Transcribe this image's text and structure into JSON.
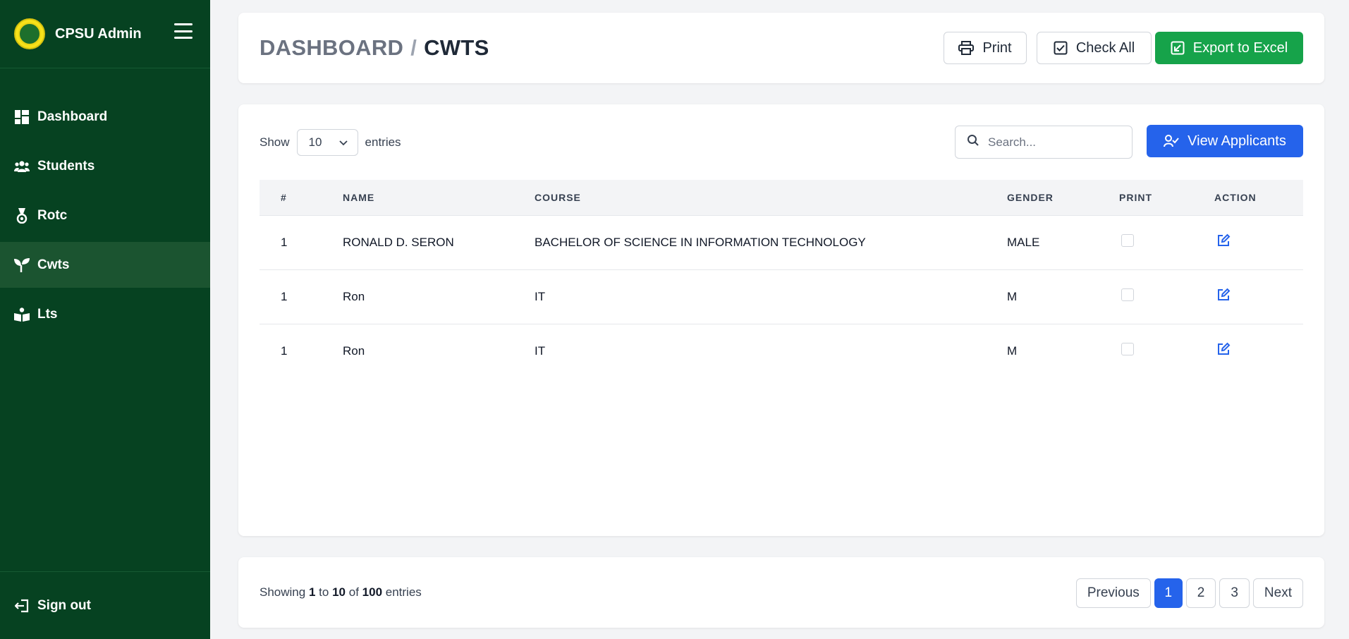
{
  "sidebar": {
    "brand_title": "CPSU Admin",
    "items": [
      {
        "label": "Dashboard",
        "icon": "dashboard-icon",
        "active": false
      },
      {
        "label": "Students",
        "icon": "users-icon",
        "active": false
      },
      {
        "label": "Rotc",
        "icon": "medal-icon",
        "active": false
      },
      {
        "label": "Cwts",
        "icon": "seedling-icon",
        "active": true
      },
      {
        "label": "Lts",
        "icon": "reader-icon",
        "active": false
      }
    ],
    "signout_label": "Sign out"
  },
  "header": {
    "crumb_root": "DASHBOARD",
    "crumb_sep": "/",
    "crumb_current": "CWTS",
    "print_label": "Print",
    "check_all_label": "Check All",
    "export_label": "Export to Excel"
  },
  "controls": {
    "show_label": "Show",
    "entries_value": "10",
    "entries_label": "entries",
    "search_placeholder": "Search...",
    "view_applicants_label": "View Applicants"
  },
  "table": {
    "columns": [
      "#",
      "NAME",
      "COURSE",
      "GENDER",
      "PRINT",
      "ACTION"
    ],
    "rows": [
      {
        "num": "1",
        "name": "RONALD D. SERON",
        "course": "BACHELOR OF SCIENCE IN INFORMATION TECHNOLOGY",
        "gender": "MALE",
        "print_checked": false
      },
      {
        "num": "1",
        "name": "Ron",
        "course": "IT",
        "gender": "M",
        "print_checked": false
      },
      {
        "num": "1",
        "name": "Ron",
        "course": "IT",
        "gender": "M",
        "print_checked": false
      }
    ]
  },
  "footer": {
    "showing_prefix": "Showing",
    "from": "1",
    "to_word": "to",
    "to": "10",
    "of_word": "of",
    "total": "100",
    "entries_word": "entries",
    "prev_label": "Previous",
    "pages": [
      "1",
      "2",
      "3"
    ],
    "next_label": "Next"
  },
  "colors": {
    "sidebar_bg": "#064221",
    "sidebar_active": "#1b5430",
    "green_button": "#16a34a",
    "blue_button": "#2563eb"
  }
}
